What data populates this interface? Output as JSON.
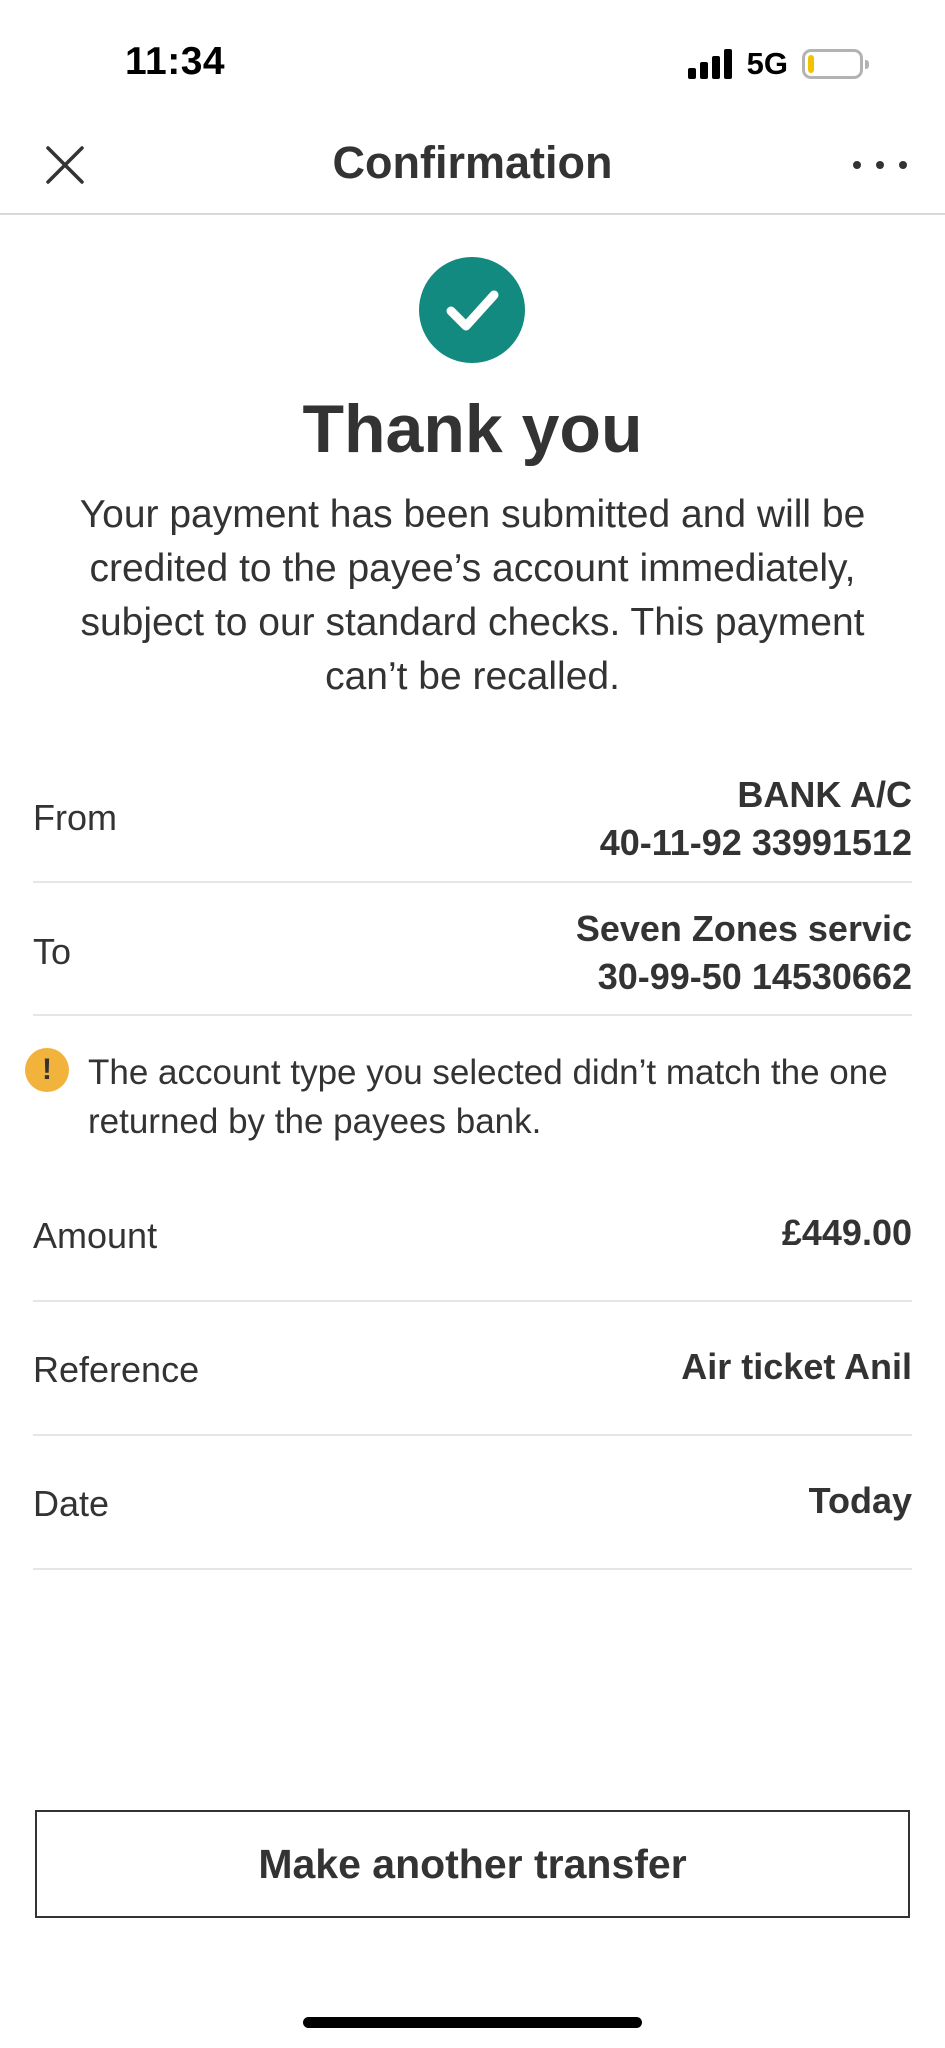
{
  "status_bar": {
    "time": "11:34",
    "network": "5G",
    "battery_level": 0.12,
    "battery_color": "#f2c200"
  },
  "header": {
    "title": "Confirmation",
    "close_icon": "close-icon",
    "more_icon": "more-options-icon"
  },
  "success": {
    "icon": "checkmark-icon",
    "icon_color": "#138a80",
    "title": "Thank you",
    "message": "Your payment has been submitted and will be credited to the payee’s account immediately, subject to our standard checks. This payment can’t be recalled."
  },
  "details": {
    "from": {
      "label": "From",
      "name": "BANK A/C",
      "account": "40-11-92 33991512"
    },
    "to": {
      "label": "To",
      "name": "Seven Zones servic",
      "account": "30-99-50 14530662"
    },
    "warning": {
      "icon_text": "!",
      "icon_color": "#f2b33d",
      "text": "The account type you selected didn’t match the one returned by the payees bank."
    },
    "amount": {
      "label": "Amount",
      "value": "£449.00"
    },
    "reference": {
      "label": "Reference",
      "value": "Air ticket Anil"
    },
    "date": {
      "label": "Date",
      "value": "Today"
    }
  },
  "actions": {
    "make_another_label": "Make another transfer"
  }
}
